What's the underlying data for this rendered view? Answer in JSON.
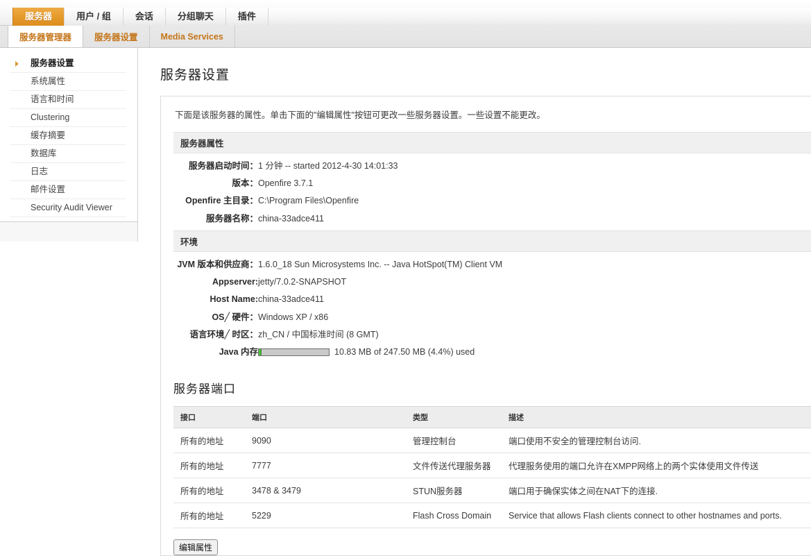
{
  "nav": {
    "main_tabs": [
      {
        "label": "服务器",
        "active": true
      },
      {
        "label": "用户 / 组",
        "active": false
      },
      {
        "label": "会话",
        "active": false
      },
      {
        "label": "分组聊天",
        "active": false
      },
      {
        "label": "插件",
        "active": false
      }
    ],
    "sub_tabs": [
      {
        "label": "服务器管理器",
        "active": true
      },
      {
        "label": "服务器设置",
        "active": false
      },
      {
        "label": "Media Services",
        "active": false
      }
    ]
  },
  "sidebar": {
    "items": [
      {
        "label": "服务器设置",
        "active": true
      },
      {
        "label": "系统属性",
        "active": false
      },
      {
        "label": "语言和时间",
        "active": false
      },
      {
        "label": "Clustering",
        "active": false
      },
      {
        "label": "缓存摘要",
        "active": false
      },
      {
        "label": "数据库",
        "active": false
      },
      {
        "label": "日志",
        "active": false
      },
      {
        "label": "邮件设置",
        "active": false
      },
      {
        "label": "Security Audit Viewer",
        "active": false
      }
    ]
  },
  "main": {
    "page_title": "服务器设置",
    "intro": "下面是该服务器的属性。单击下面的\"编辑属性\"按钮可更改一些服务器设置。一些设置不能更改。",
    "server_properties": {
      "heading": "服务器属性",
      "rows": [
        {
          "key": "服务器启动时间：",
          "value": "1 分钟 -- started 2012-4-30 14:01:33"
        },
        {
          "key": "版本：",
          "value": "Openfire 3.7.1"
        },
        {
          "key": "Openfire 主目录：",
          "value": "C:\\Program Files\\Openfire"
        },
        {
          "key": "服务器名称：",
          "value": "china-33adce411"
        }
      ]
    },
    "environment": {
      "heading": "环境",
      "rows": [
        {
          "key": "JVM 版本和供应商：",
          "value": "1.6.0_18 Sun Microsystems Inc. -- Java HotSpot(TM) Client VM"
        },
        {
          "key": "Appserver:",
          "value": "jetty/7.0.2-SNAPSHOT"
        },
        {
          "key": "Host Name:",
          "value": "china-33adce411"
        },
        {
          "key": "OS╱ 硬件：",
          "value": "Windows XP / x86"
        },
        {
          "key": "语言环境╱ 时区：",
          "value": "zh_CN / 中国标准时间 (8 GMT)"
        }
      ],
      "memory": {
        "key": "Java 内存",
        "value": "10.83 MB of 247.50 MB (4.4%) used",
        "percent": 4.4,
        "fill_color": "#52bb3f"
      }
    },
    "server_ports": {
      "heading": "服务器端口",
      "columns": [
        "接口",
        "端口",
        "类型",
        "描述"
      ],
      "rows": [
        {
          "interface": "所有的地址",
          "port": "9090",
          "type": "管理控制台",
          "description": "端口使用不安全的管理控制台访问."
        },
        {
          "interface": "所有的地址",
          "port": "7777",
          "type": "文件传送代理服务器",
          "description": "代理服务使用的端口允许在XMPP网络上的两个实体使用文件传送"
        },
        {
          "interface": "所有的地址",
          "port": "3478 & 3479",
          "type": "STUN服务器",
          "description": "端口用于确保实体之间在NAT下的连接."
        },
        {
          "interface": "所有的地址",
          "port": "5229",
          "type": "Flash Cross Domain",
          "description": "Service that allows Flash clients connect to other hostnames and ports."
        }
      ]
    },
    "edit_button_label": "编辑属性"
  },
  "colors": {
    "accent_orange": "#dc8c1c",
    "subtab_text": "#c4761a",
    "section_header_bg": "#f0f0f0",
    "memory_green": "#52bb3f"
  }
}
